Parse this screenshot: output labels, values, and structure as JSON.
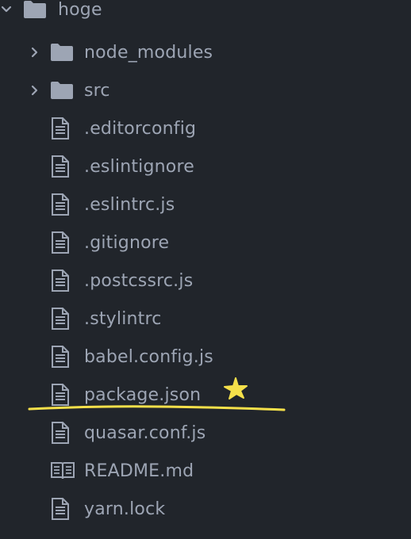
{
  "tree": {
    "root": {
      "label": "hoge",
      "expanded": true,
      "icon": "folder-icon"
    },
    "items": [
      {
        "label": "node_modules",
        "type": "folder",
        "icon": "folder-icon",
        "expanded": false
      },
      {
        "label": "src",
        "type": "folder",
        "icon": "folder-icon",
        "expanded": false
      },
      {
        "label": ".editorconfig",
        "type": "file",
        "icon": "file-text-icon"
      },
      {
        "label": ".eslintignore",
        "type": "file",
        "icon": "file-text-icon"
      },
      {
        "label": ".eslintrc.js",
        "type": "file",
        "icon": "file-text-icon"
      },
      {
        "label": ".gitignore",
        "type": "file",
        "icon": "file-text-icon"
      },
      {
        "label": ".postcssrc.js",
        "type": "file",
        "icon": "file-text-icon"
      },
      {
        "label": ".stylintrc",
        "type": "file",
        "icon": "file-text-icon"
      },
      {
        "label": "babel.config.js",
        "type": "file",
        "icon": "file-text-icon"
      },
      {
        "label": "package.json",
        "type": "file",
        "icon": "file-text-icon",
        "highlighted": true
      },
      {
        "label": "quasar.conf.js",
        "type": "file",
        "icon": "file-text-icon"
      },
      {
        "label": "README.md",
        "type": "file",
        "icon": "book-icon"
      },
      {
        "label": "yarn.lock",
        "type": "file",
        "icon": "file-text-icon"
      }
    ]
  },
  "colors": {
    "background": "#21252b",
    "text": "#9da5b4",
    "icon": "#9da5b4",
    "annotation": "#f5e04a"
  }
}
